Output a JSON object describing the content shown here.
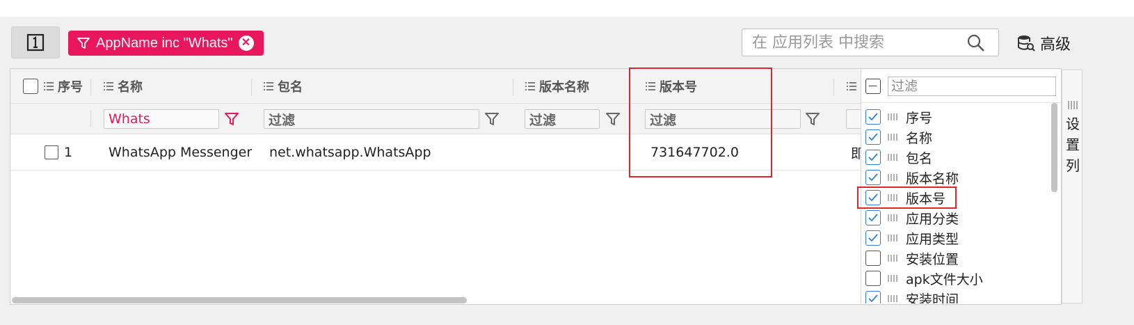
{
  "toolbar": {
    "toggle_icon": "one-box-icon",
    "filter_chip": {
      "label": "AppName inc \"Whats\"",
      "icon": "funnel-icon",
      "close_icon": "close-circle-icon"
    },
    "search": {
      "placeholder": "在 应用列表 中搜索",
      "value": ""
    },
    "advanced_label": "高级"
  },
  "grid": {
    "columns": [
      {
        "key": "index",
        "label": "序号"
      },
      {
        "key": "name",
        "label": "名称"
      },
      {
        "key": "package",
        "label": "包名"
      },
      {
        "key": "version_name",
        "label": "版本名称"
      },
      {
        "key": "version_code",
        "label": "版本号"
      }
    ],
    "filters": {
      "name": "Whats",
      "package_placeholder": "过滤",
      "version_name_placeholder": "过滤",
      "version_code_placeholder": "过滤"
    },
    "rows": [
      {
        "index": "1",
        "name": "WhatsApp Messenger",
        "package": "net.whatsapp.WhatsApp",
        "version_name": "",
        "version_code": "731647702.0",
        "next_col_partial": "即"
      }
    ]
  },
  "column_panel": {
    "filter_placeholder": "过滤",
    "items": [
      {
        "label": "序号",
        "checked": true
      },
      {
        "label": "名称",
        "checked": true
      },
      {
        "label": "包名",
        "checked": true
      },
      {
        "label": "版本名称",
        "checked": true
      },
      {
        "label": "版本号",
        "checked": true
      },
      {
        "label": "应用分类",
        "checked": true
      },
      {
        "label": "应用类型",
        "checked": true
      },
      {
        "label": "安装位置",
        "checked": false
      },
      {
        "label": "apk文件大小",
        "checked": false
      },
      {
        "label": "安装时间",
        "checked": true
      }
    ],
    "side_tab_label": "设置列"
  },
  "colors": {
    "accent": "#e8175d",
    "highlight": "#e0242d",
    "check": "#2f7fd6"
  }
}
